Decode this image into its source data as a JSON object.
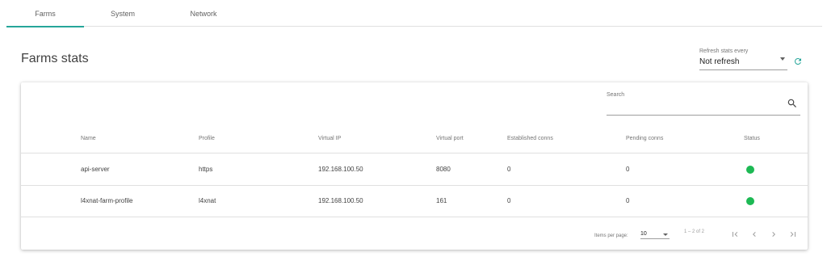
{
  "tabs": [
    {
      "label": "Farms",
      "active": true
    },
    {
      "label": "System",
      "active": false
    },
    {
      "label": "Network",
      "active": false
    }
  ],
  "page_title": "Farms stats",
  "refresh": {
    "label": "Refresh stats every",
    "value": "Not refresh",
    "icon": "refresh-icon"
  },
  "search": {
    "label": "Search",
    "value": "",
    "icon": "search-icon"
  },
  "table": {
    "columns": [
      "Name",
      "Profile",
      "Virtual IP",
      "Virtual port",
      "Established conns",
      "Pending conns",
      "Status"
    ],
    "rows": [
      {
        "name": "api-server",
        "profile": "https",
        "vip": "192.168.100.50",
        "vport": "8080",
        "established": "0",
        "pending": "0",
        "status": "up"
      },
      {
        "name": "l4xnat-farm-profile",
        "profile": "l4xnat",
        "vip": "192.168.100.50",
        "vport": "161",
        "established": "0",
        "pending": "0",
        "status": "up"
      }
    ]
  },
  "paginator": {
    "items_per_page_label": "Items per page:",
    "items_per_page_value": "10",
    "range": "1 – 2 of 2"
  },
  "colors": {
    "accent": "#26a69a",
    "status_up": "#1db954",
    "refresh_icon": "#26a69a"
  }
}
